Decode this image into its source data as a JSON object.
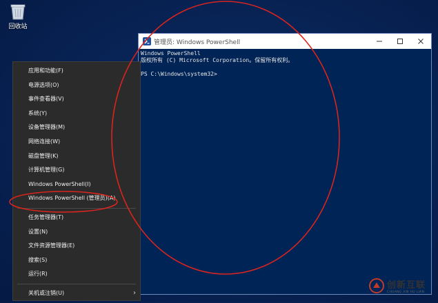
{
  "desktop": {
    "recycle_bin_label": "回收站"
  },
  "powershell_window": {
    "title": "管理员: Windows PowerShell",
    "console_lines": [
      "Windows PowerShell",
      "版权所有 (C) Microsoft Corporation。保留所有权利。",
      "",
      "PS C:\\Windows\\system32>"
    ],
    "background_color": "#012456"
  },
  "winx_menu": {
    "group1": [
      {
        "name": "apps-features",
        "label": "应用和功能(F)"
      },
      {
        "name": "power-options",
        "label": "电源选项(O)"
      },
      {
        "name": "event-viewer",
        "label": "事件查看器(V)"
      },
      {
        "name": "system",
        "label": "系统(Y)"
      },
      {
        "name": "device-manager",
        "label": "设备管理器(M)"
      },
      {
        "name": "network-connections",
        "label": "网络连接(W)"
      },
      {
        "name": "disk-management",
        "label": "磁盘管理(K)"
      },
      {
        "name": "computer-management",
        "label": "计算机管理(G)"
      },
      {
        "name": "windows-powershell",
        "label": "Windows PowerShell(I)"
      },
      {
        "name": "windows-powershell-admin",
        "label": "Windows PowerShell (管理员)(A)"
      }
    ],
    "group2": [
      {
        "name": "task-manager",
        "label": "任务管理器(T)"
      },
      {
        "name": "settings",
        "label": "设置(N)"
      },
      {
        "name": "file-explorer",
        "label": "文件资源管理器(E)"
      },
      {
        "name": "search",
        "label": "搜索(S)"
      },
      {
        "name": "run",
        "label": "运行(R)"
      }
    ],
    "group3": [
      {
        "name": "shutdown-signout",
        "label": "关机或注销(U)",
        "has_submenu": true
      }
    ]
  },
  "annotation_color": "#d9251d",
  "watermark": {
    "cn": "创新互联",
    "en": "CHUANG XIN HU LIAN"
  }
}
